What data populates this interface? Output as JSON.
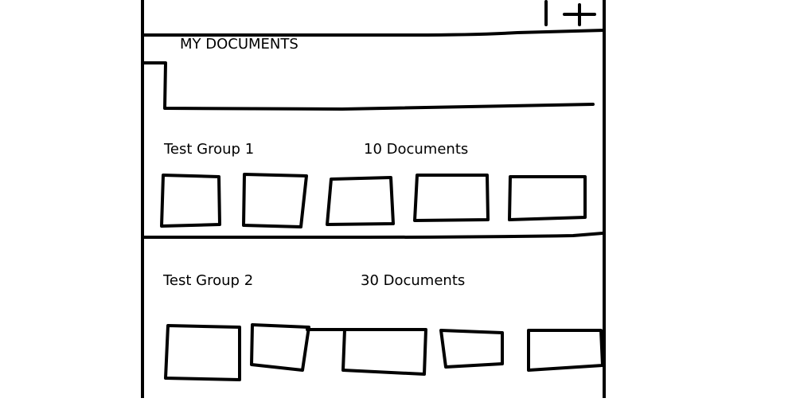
{
  "header": {
    "add_icon": "plus-icon"
  },
  "documents_panel": {
    "title": "MY DOCUMENTS"
  },
  "groups": [
    {
      "name": "Test Group 1",
      "count_label": "10 Documents"
    },
    {
      "name": "Test Group 2",
      "count_label": "30 Documents"
    }
  ]
}
